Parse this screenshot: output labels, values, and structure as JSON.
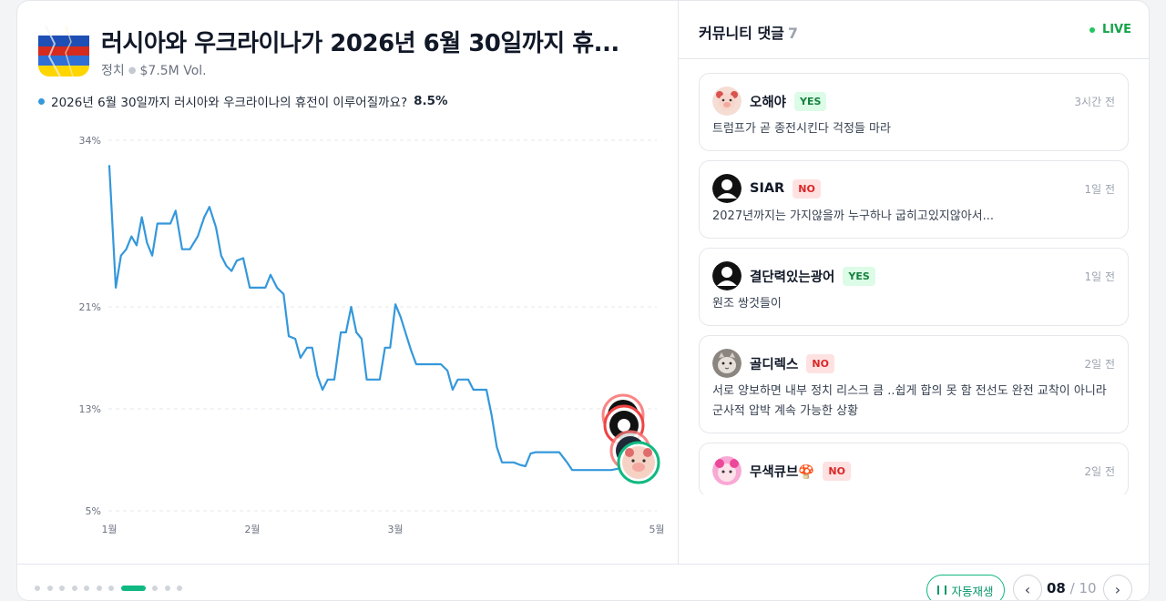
{
  "market": {
    "title": "러시아와 우크라이나가 2026년 6월 30일까지 휴...",
    "category": "정치",
    "volume": "$7.5M Vol.",
    "question": "2026년 6월 30일까지 러시아와 우크라이나의 휴전이 이루어질까요?",
    "probability": "8.5%",
    "icon": "russia-ukraine-flag-icon"
  },
  "chart_data": {
    "type": "line",
    "series": [
      {
        "color": "#3498db",
        "points": [
          [
            0.0,
            32.0
          ],
          [
            0.5,
            22.5
          ],
          [
            0.9,
            25.0
          ],
          [
            1.3,
            25.5
          ],
          [
            1.7,
            26.5
          ],
          [
            2.1,
            25.8
          ],
          [
            2.5,
            28.0
          ],
          [
            2.9,
            26.0
          ],
          [
            3.3,
            25.0
          ],
          [
            3.7,
            27.5
          ],
          [
            4.2,
            27.5
          ],
          [
            4.7,
            27.5
          ],
          [
            5.1,
            28.5
          ],
          [
            5.6,
            25.5
          ],
          [
            6.2,
            25.5
          ],
          [
            6.8,
            26.5
          ],
          [
            7.3,
            28.0
          ],
          [
            7.7,
            28.8
          ],
          [
            8.2,
            27.2
          ],
          [
            8.6,
            25.0
          ],
          [
            9.0,
            24.2
          ],
          [
            9.4,
            23.8
          ],
          [
            9.8,
            24.6
          ],
          [
            10.3,
            24.8
          ],
          [
            10.8,
            22.5
          ],
          [
            11.4,
            22.5
          ],
          [
            12.0,
            22.5
          ],
          [
            12.4,
            23.5
          ],
          [
            12.9,
            22.5
          ],
          [
            13.4,
            22.0
          ],
          [
            13.8,
            18.7
          ],
          [
            14.3,
            18.5
          ],
          [
            14.7,
            17.0
          ],
          [
            15.2,
            17.8
          ],
          [
            15.6,
            17.8
          ],
          [
            16.0,
            15.6
          ],
          [
            16.4,
            14.5
          ],
          [
            16.8,
            15.3
          ],
          [
            17.3,
            15.3
          ],
          [
            17.8,
            19.0
          ],
          [
            18.2,
            19.0
          ],
          [
            18.6,
            21.0
          ],
          [
            19.0,
            19.0
          ],
          [
            19.4,
            18.5
          ],
          [
            19.8,
            15.3
          ],
          [
            20.3,
            15.3
          ],
          [
            20.8,
            15.3
          ],
          [
            21.2,
            17.8
          ],
          [
            21.6,
            17.8
          ],
          [
            22.0,
            21.2
          ],
          [
            22.4,
            20.2
          ],
          [
            22.8,
            18.9
          ],
          [
            23.2,
            17.6
          ],
          [
            23.6,
            16.5
          ],
          [
            24.0,
            16.5
          ],
          [
            24.5,
            16.5
          ],
          [
            25.0,
            16.5
          ],
          [
            25.5,
            16.5
          ],
          [
            26.0,
            16.0
          ],
          [
            26.4,
            14.5
          ],
          [
            26.8,
            15.3
          ],
          [
            27.2,
            15.3
          ],
          [
            27.6,
            15.3
          ],
          [
            28.0,
            14.5
          ],
          [
            28.6,
            14.5
          ],
          [
            29.0,
            14.5
          ],
          [
            29.4,
            12.5
          ],
          [
            29.8,
            10.0
          ],
          [
            30.2,
            8.8
          ],
          [
            30.6,
            8.8
          ],
          [
            31.1,
            8.8
          ],
          [
            31.6,
            8.6
          ],
          [
            32.0,
            8.5
          ],
          [
            32.4,
            9.5
          ],
          [
            32.8,
            9.6
          ],
          [
            33.2,
            9.6
          ],
          [
            33.7,
            9.6
          ],
          [
            34.2,
            9.6
          ],
          [
            34.6,
            9.6
          ],
          [
            35.2,
            8.8
          ],
          [
            35.6,
            8.2
          ],
          [
            36.0,
            8.2
          ],
          [
            36.5,
            8.2
          ],
          [
            37.0,
            8.2
          ],
          [
            37.6,
            8.2
          ],
          [
            38.2,
            8.2
          ],
          [
            38.6,
            8.2
          ],
          [
            39.1,
            8.3
          ],
          [
            39.5,
            8.5
          ],
          [
            40.0,
            8.5
          ]
        ]
      }
    ],
    "y_ticks": [
      "34%",
      "21%",
      "13%",
      "5%"
    ],
    "x_ticks": [
      "1월",
      "2월",
      "3월",
      "5월"
    ],
    "grid": true
  },
  "comments": {
    "title": "커뮤니티 댓글",
    "count": "7",
    "live_label": "LIVE",
    "items": [
      {
        "name": "오해야",
        "badge": "YES",
        "time": "3시간 전",
        "text": "트럼프가 곧 종전시킨다 걱정들 마라",
        "avatar": "pig-avatar-icon"
      },
      {
        "name": "SIAR",
        "badge": "NO",
        "time": "1일 전",
        "text": "2027년까지는 가지않을까 누구하나 굽히고있지않아서...",
        "avatar": "default-user-avatar-icon"
      },
      {
        "name": "결단력있는광어",
        "badge": "YES",
        "time": "1일 전",
        "text": "원조 쌍것들이",
        "avatar": "default-user-avatar-icon"
      },
      {
        "name": "골디렉스",
        "badge": "NO",
        "time": "2일 전",
        "text": "서로 양보하면 내부 정치 리스크 큼 ..쉽게 합의 못 함 전선도 완전 교착이 아니라 군사적 압박 계속 가능한 상황",
        "avatar": "cat-avatar-icon"
      },
      {
        "name": "무색큐브🍄",
        "badge": "NO",
        "time": "2일 전",
        "text": "",
        "avatar": "pink-character-avatar-icon"
      }
    ]
  },
  "footer": {
    "autoplay_label": "자동재생",
    "page_current": "08",
    "page_total": "10",
    "page_sep": "/",
    "slide_count": 11,
    "active_slide": 8
  }
}
